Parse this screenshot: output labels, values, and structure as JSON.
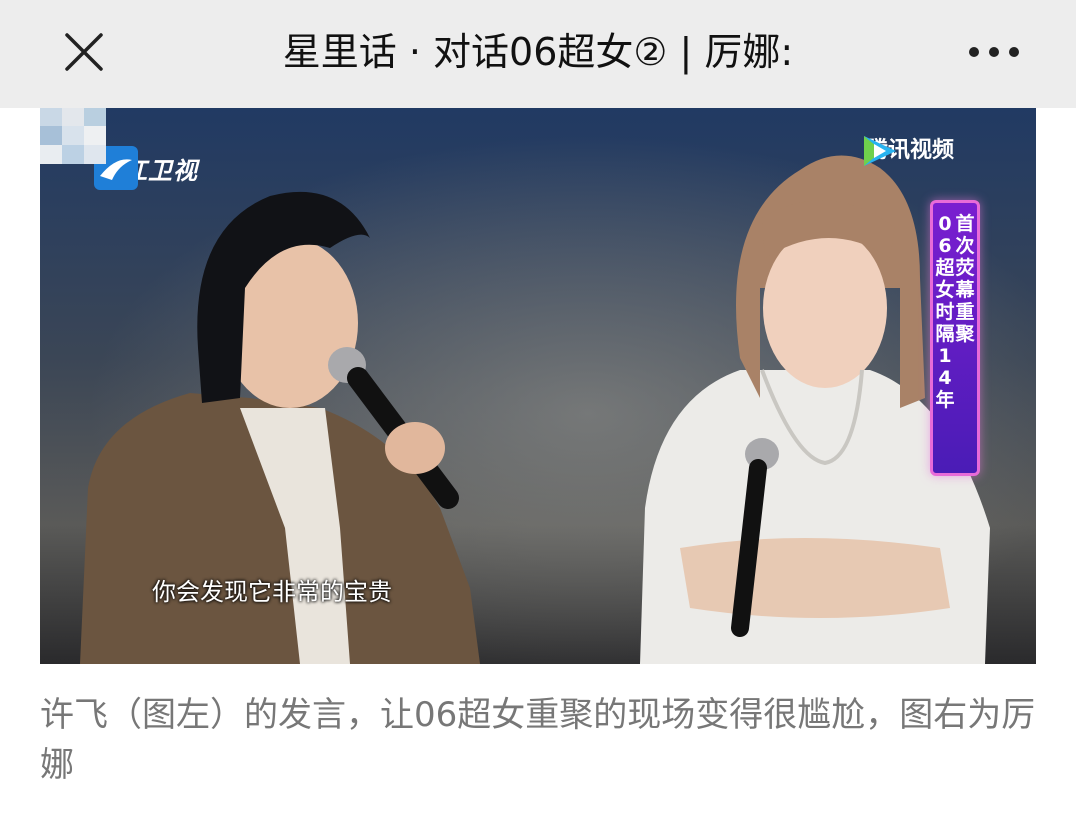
{
  "header": {
    "title": "星里话 · 对话06超女② | 厉娜:",
    "close_icon": "close-icon",
    "more_icon": "more-icon"
  },
  "video_frame": {
    "broadcaster_logo": "浙江卫视",
    "platform_logo": "腾讯视频",
    "banner_lines": [
      "首次荧幕重聚",
      "06超女时隔14年"
    ],
    "subtitle": "你会发现它非常的宝贵"
  },
  "caption": "许飞（图左）的发言，让06超女重聚的现场变得很尴尬，图右为厉娜",
  "colors": {
    "topbar_bg": "#ededed",
    "caption_text": "#777777",
    "banner_purple": "#6a1ec8",
    "banner_border": "#e86bd8"
  }
}
